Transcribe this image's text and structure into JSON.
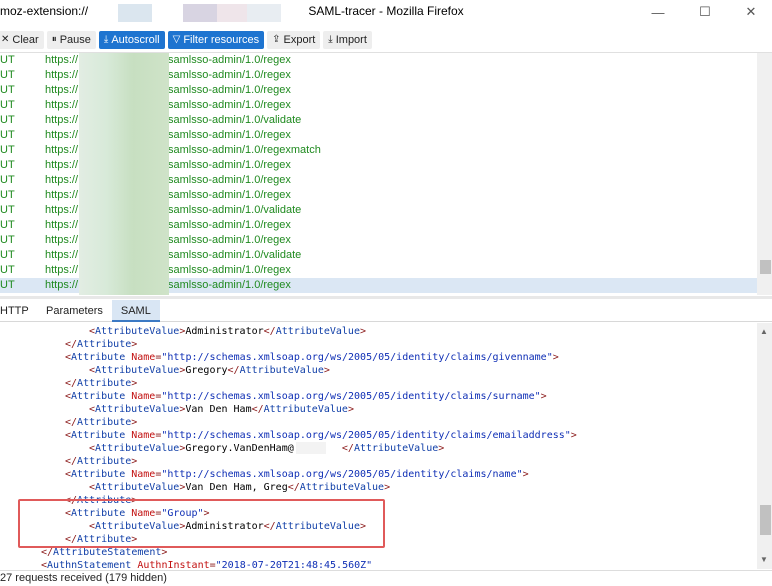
{
  "window": {
    "url": "moz-extension://",
    "title": "SAML-tracer - Mozilla Firefox",
    "controls": {
      "minimize": "—",
      "maximize": "☐",
      "close": "✕"
    }
  },
  "toolbar": {
    "clear": {
      "icon": "✕",
      "label": "Clear"
    },
    "pause": {
      "icon": "⏸",
      "label": "Pause"
    },
    "autoscroll": {
      "icon": "⤓",
      "label": "Autoscroll"
    },
    "filter": {
      "icon": "▽",
      "label": "Filter resources"
    },
    "export": {
      "icon": "⇪",
      "label": "Export"
    },
    "import": {
      "icon": "⤓",
      "label": "Import"
    }
  },
  "requests": [
    {
      "method": "UT",
      "url": "https://",
      "path": "samlsso-admin/1.0/regex"
    },
    {
      "method": "UT",
      "url": "https://",
      "path": "samlsso-admin/1.0/regex"
    },
    {
      "method": "UT",
      "url": "https://",
      "path": "samlsso-admin/1.0/regex"
    },
    {
      "method": "UT",
      "url": "https://",
      "path": "samlsso-admin/1.0/regex"
    },
    {
      "method": "UT",
      "url": "https://",
      "path": "samlsso-admin/1.0/validate"
    },
    {
      "method": "UT",
      "url": "https://",
      "path": "samlsso-admin/1.0/regex"
    },
    {
      "method": "UT",
      "url": "https://",
      "path": "samlsso-admin/1.0/regexmatch"
    },
    {
      "method": "UT",
      "url": "https://",
      "path": "samlsso-admin/1.0/regex"
    },
    {
      "method": "UT",
      "url": "https://",
      "path": "samlsso-admin/1.0/regex"
    },
    {
      "method": "UT",
      "url": "https://",
      "path": "samlsso-admin/1.0/regex"
    },
    {
      "method": "UT",
      "url": "https://",
      "path": "samlsso-admin/1.0/validate"
    },
    {
      "method": "UT",
      "url": "https://",
      "path": "samlsso-admin/1.0/regex"
    },
    {
      "method": "UT",
      "url": "https://",
      "path": "samlsso-admin/1.0/regex"
    },
    {
      "method": "UT",
      "url": "https://",
      "path": "samlsso-admin/1.0/validate"
    },
    {
      "method": "UT",
      "url": "https://",
      "path": "samlsso-admin/1.0/regex"
    },
    {
      "method": "UT",
      "url": "https://",
      "path": "samlsso-admin/1.0/regex"
    }
  ],
  "tabs": [
    "HTTP",
    "Parameters",
    "SAML"
  ],
  "active_tab": "SAML",
  "xml": {
    "attribute_tag": "Attribute",
    "attribute_value_tag": "AttributeValue",
    "attribute_statement_tag": "AttributeStatement",
    "authn_statement_tag": "AuthnStatement",
    "name_attr": "Name",
    "authn_instant_attr": "AuthnInstant",
    "authn_instant_value": "\"2018-07-20T21:48:45.560Z\"",
    "v_admin_top": "Administrator",
    "a_givenname": "\"http://schemas.xmlsoap.org/ws/2005/05/identity/claims/givenname\"",
    "v_given": "Gregory",
    "a_surname": "\"http://schemas.xmlsoap.org/ws/2005/05/identity/claims/surname\"",
    "v_surname": "Van Den Ham",
    "a_email": "\"http://schemas.xmlsoap.org/ws/2005/05/identity/claims/emailaddress\"",
    "v_email": "Gregory.VanDenHam@",
    "a_name": "\"http://schemas.xmlsoap.org/ws/2005/05/identity/claims/name\"",
    "v_name": "Van Den Ham, Greg",
    "a_group": "\"Group\"",
    "v_group": "Administrator"
  },
  "status": "27 requests received (179 hidden)"
}
